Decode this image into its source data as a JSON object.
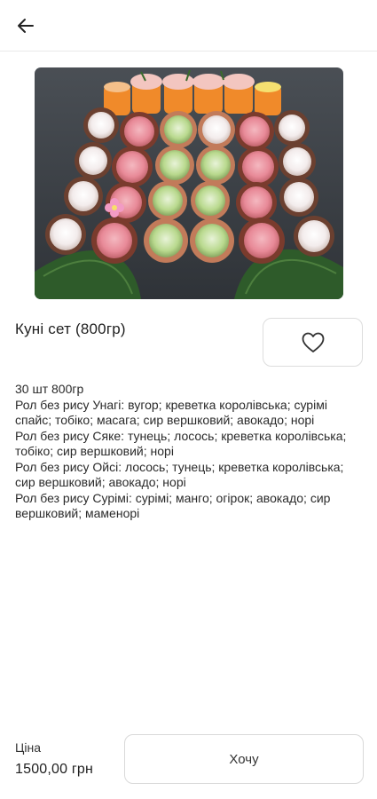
{
  "header": {
    "back_icon": "arrow-left-icon"
  },
  "product": {
    "image_alt": "sushi-set-photo",
    "title": "Куні сет (800гр)",
    "favorite_icon": "heart-outline-icon",
    "description": [
      "30 шт 800гр",
      "Рол без рису Унагі: вугор; креветка королівська; сурімі спайс; тобіко; масага; сир вершковий; авокадо; норі",
      "Рол без рису Сяке: тунець; лосось; креветка королівська; тобіко; сир вершковий; норі",
      "Рол без рису Ойсі: лосось; тунець; креветка королівська; сир вершковий; авокадо; норі",
      "Рол без рису Сурімі: сурімі; манго; огірок; авокадо; сир вершковий; маменорі"
    ]
  },
  "footer": {
    "price_label": "Ціна",
    "price_value": "1500,00 грн",
    "want_label": "Хочу"
  }
}
